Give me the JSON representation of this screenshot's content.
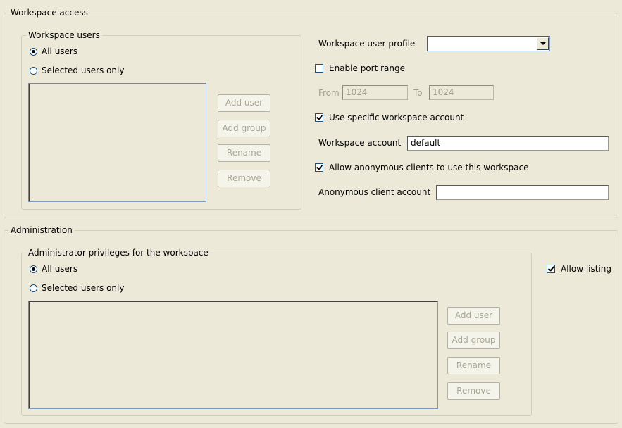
{
  "workspace_access": {
    "title": "Workspace access",
    "workspace_users": {
      "title": "Workspace users",
      "all_users": "All users",
      "selected_users": "Selected users only",
      "buttons": {
        "add_user": "Add user",
        "add_group": "Add group",
        "rename": "Rename",
        "remove": "Remove"
      }
    },
    "user_profile_label": "Workspace user profile",
    "user_profile_value": "",
    "enable_port_range": "Enable port range",
    "from_label": "From",
    "from_value": "1024",
    "to_label": "To",
    "to_value": "1024",
    "use_specific_account": "Use specific workspace account",
    "workspace_account_label": "Workspace account",
    "workspace_account_value": "default",
    "allow_anonymous": "Allow anonymous clients to use this workspace",
    "anonymous_account_label": "Anonymous client account",
    "anonymous_account_value": ""
  },
  "administration": {
    "title": "Administration",
    "admin_privileges": {
      "title": "Administrator privileges for the workspace",
      "all_users": "All users",
      "selected_users": "Selected users only",
      "buttons": {
        "add_user": "Add user",
        "add_group": "Add group",
        "rename": "Rename",
        "remove": "Remove"
      }
    },
    "allow_listing": "Allow listing"
  }
}
